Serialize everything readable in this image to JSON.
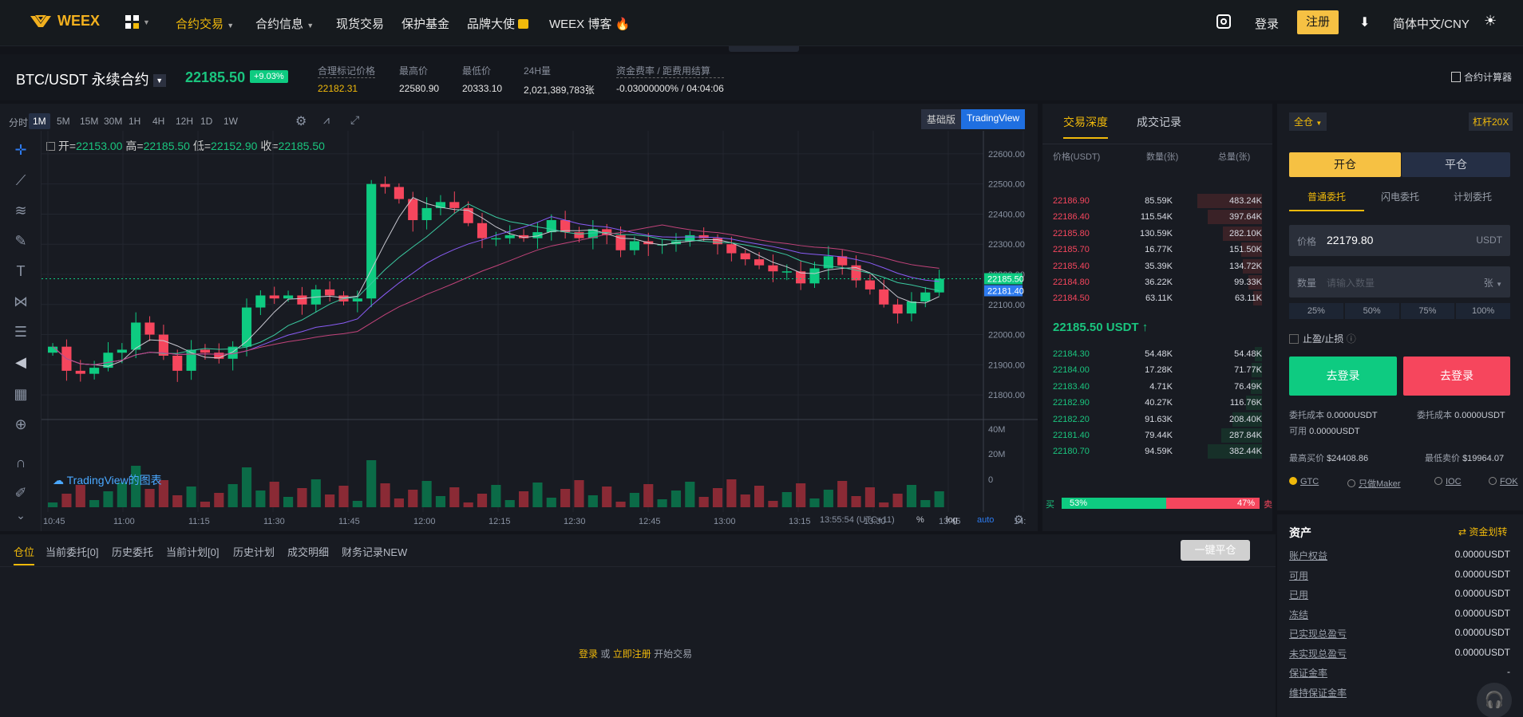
{
  "brand": {
    "logo_text": "WEEX",
    "accent": "#f0b90b",
    "up": "#0ecb81",
    "down": "#f6465d"
  },
  "nav": {
    "items": [
      {
        "label": "合约交易",
        "active": true
      },
      {
        "label": "合约信息"
      },
      {
        "label": "现货交易"
      },
      {
        "label": "保护基金"
      },
      {
        "label": "品牌大使"
      },
      {
        "label": "WEEX 博客"
      }
    ],
    "login": "登录",
    "register": "注册",
    "lang": "简体中文/CNY"
  },
  "ticker": {
    "symbol": "BTC/USDT 永续合约",
    "price": "22185.50",
    "change": "+9.03%",
    "stats": [
      {
        "label": "合理标记价格",
        "value": "22182.31",
        "highlight": true
      },
      {
        "label": "最高价",
        "value": "22580.90"
      },
      {
        "label": "最低价",
        "value": "20333.10"
      },
      {
        "label": "24H量",
        "value": "2,021,389,783张"
      },
      {
        "label": "资金费率 / 距费用结算",
        "value": "-0.03000000% / 04:04:06"
      }
    ],
    "calculator": "合约计算器"
  },
  "chart": {
    "timeframes": [
      "分时",
      "1M",
      "5M",
      "15M",
      "30M",
      "1H",
      "4H",
      "12H",
      "1D",
      "1W"
    ],
    "active_tf": "1M",
    "mode_basic": "基础版",
    "mode_tv": "TradingView",
    "ohlc": {
      "o_label": "开=",
      "o": "22153.00",
      "h_label": "高=",
      "h": "22185.50",
      "l_label": "低=",
      "l": "22152.90",
      "c_label": "收=",
      "c": "22185.50"
    },
    "price_ticks": [
      "22600.00",
      "22500.00",
      "22400.00",
      "22300.00",
      "22200.00",
      "22100.00",
      "22000.00",
      "21900.00",
      "21800.00"
    ],
    "price_tags": [
      "22185.50",
      "22181.40"
    ],
    "vol_ticks": [
      "40M",
      "20M",
      "0"
    ],
    "time_ticks": [
      "10:45",
      "11:00",
      "11:15",
      "11:30",
      "11:45",
      "12:00",
      "12:15",
      "12:30",
      "12:45",
      "13:00",
      "13:15",
      "13:30",
      "13:45",
      "14:"
    ],
    "watermark": "TradingView的图表",
    "footer": {
      "time": "13:55:54 (UTC+11)",
      "pct": "%",
      "log": "log",
      "auto": "auto"
    }
  },
  "chart_data": {
    "type": "candlestick",
    "series": [
      {
        "name": "price",
        "close": [
          21960,
          21880,
          21870,
          21890,
          21940,
          21950,
          22040,
          22000,
          21930,
          21880,
          21950,
          21940,
          21920,
          21960,
          22090,
          22130,
          22120,
          22130,
          22100,
          22150,
          22130,
          22110,
          22120,
          22500,
          22490,
          22450,
          22380,
          22420,
          22440,
          22420,
          22370,
          22320,
          22320,
          22330,
          22320,
          22340,
          22380,
          22340,
          22320,
          22350,
          22330,
          22280,
          22310,
          22300,
          22300,
          22310,
          22330,
          22320,
          22300,
          22270,
          22250,
          22230,
          22210,
          22210,
          22170,
          22220,
          22260,
          22230,
          22180,
          22150,
          22100,
          22070,
          22110,
          22140,
          22185.5
        ]
      }
    ],
    "ylim": [
      21750,
      22650
    ]
  },
  "orderbook": {
    "tabs": [
      "交易深度",
      "成交记录"
    ],
    "headers": [
      "价格(USDT)",
      "数量(张)",
      "总量(张)"
    ],
    "asks": [
      [
        "22186.90",
        "85.59K",
        "483.24K"
      ],
      [
        "22186.40",
        "115.54K",
        "397.64K"
      ],
      [
        "22185.80",
        "130.59K",
        "282.10K"
      ],
      [
        "22185.70",
        "16.77K",
        "151.50K"
      ],
      [
        "22185.40",
        "35.39K",
        "134.72K"
      ],
      [
        "22184.80",
        "36.22K",
        "99.33K"
      ],
      [
        "22184.50",
        "63.11K",
        "63.11K"
      ]
    ],
    "ask_depth": [
      0.95,
      0.8,
      0.58,
      0.31,
      0.28,
      0.2,
      0.13
    ],
    "last": "22185.50 USDT",
    "bids": [
      [
        "22184.30",
        "54.48K",
        "54.48K"
      ],
      [
        "22184.00",
        "17.28K",
        "71.77K"
      ],
      [
        "22183.40",
        "4.71K",
        "76.49K"
      ],
      [
        "22182.90",
        "40.27K",
        "116.76K"
      ],
      [
        "22182.20",
        "91.63K",
        "208.40K"
      ],
      [
        "22181.40",
        "79.44K",
        "287.84K"
      ],
      [
        "22180.70",
        "94.59K",
        "382.44K"
      ]
    ],
    "bid_depth": [
      0.11,
      0.15,
      0.16,
      0.24,
      0.43,
      0.6,
      0.8
    ],
    "buy_label": "买",
    "sell_label": "卖",
    "buy_pct": "53%",
    "sell_pct": "47%",
    "buy_ratio": 0.53
  },
  "trade": {
    "margin_mode": "全仓",
    "leverage": "杠杆20X",
    "open": "开仓",
    "close": "平仓",
    "order_types": [
      "普通委托",
      "闪电委托",
      "计划委托"
    ],
    "price_label": "价格",
    "price_value": "22179.80",
    "price_unit": "USDT",
    "qty_label": "数量",
    "qty_placeholder": "请输入数量",
    "qty_unit": "张",
    "pcts": [
      "25%",
      "50%",
      "75%",
      "100%"
    ],
    "tpsl": "止盈/止损",
    "btn_long": "去登录",
    "btn_short": "去登录",
    "cost_l_label": "委托成本",
    "cost_l": "0.0000USDT",
    "avail_label": "可用",
    "avail": "0.0000USDT",
    "cost_r_label": "委托成本",
    "cost_r": "0.0000USDT",
    "max_buy_label": "最高买价",
    "max_buy": "$24408.86",
    "min_sell_label": "最低卖价",
    "min_sell": "$19964.07",
    "tif": [
      "GTC",
      "只做Maker",
      "IOC",
      "FOK"
    ],
    "assets_title": "资产",
    "transfer": "资金划转",
    "assets": [
      [
        "账户权益",
        "0.0000USDT"
      ],
      [
        "可用",
        "0.0000USDT"
      ],
      [
        "已用",
        "0.0000USDT"
      ],
      [
        "冻结",
        "0.0000USDT"
      ],
      [
        "已实现总盈亏",
        "0.0000USDT"
      ],
      [
        "未实现总盈亏",
        "0.0000USDT"
      ],
      [
        "保证金率",
        "-"
      ],
      [
        "维持保证金率",
        "-"
      ]
    ]
  },
  "positions": {
    "tabs": [
      "仓位",
      "当前委托[0]",
      "历史委托",
      "当前计划[0]",
      "历史计划",
      "成交明细",
      "财务记录NEW"
    ],
    "close_all": "一键平仓",
    "prompt_login": "登录",
    "prompt_or": "或",
    "prompt_register": "立即注册",
    "prompt_start": "开始交易"
  }
}
